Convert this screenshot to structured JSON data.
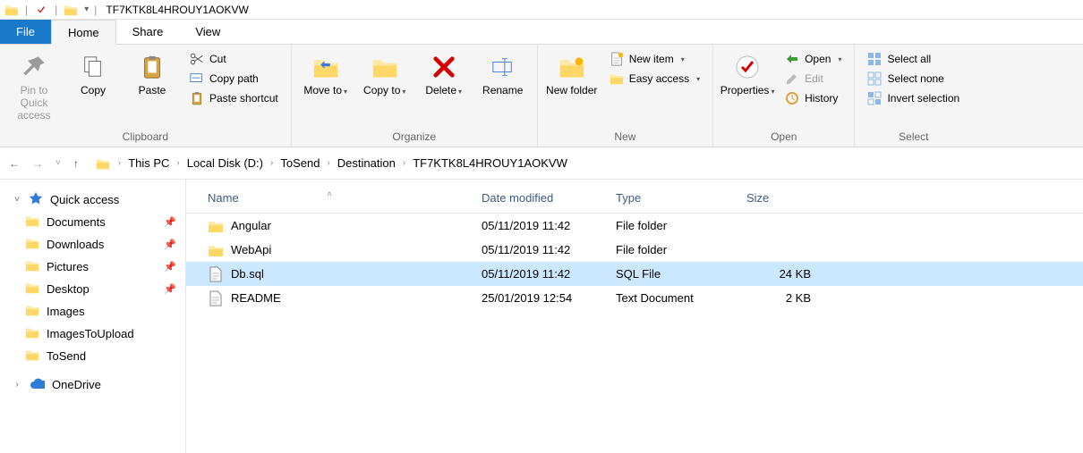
{
  "title": "TF7KTK8L4HROUY1AOKVW",
  "tabs": {
    "file": "File",
    "home": "Home",
    "share": "Share",
    "view": "View"
  },
  "ribbon": {
    "clipboard": {
      "label": "Clipboard",
      "pin": "Pin to Quick access",
      "copy": "Copy",
      "paste": "Paste",
      "cut": "Cut",
      "copy_path": "Copy path",
      "paste_shortcut": "Paste shortcut"
    },
    "organize": {
      "label": "Organize",
      "move_to": "Move to",
      "copy_to": "Copy to",
      "delete": "Delete",
      "rename": "Rename"
    },
    "new": {
      "label": "New",
      "new_folder": "New folder",
      "new_item": "New item",
      "easy_access": "Easy access"
    },
    "open": {
      "label": "Open",
      "properties": "Properties",
      "open": "Open",
      "edit": "Edit",
      "history": "History"
    },
    "select": {
      "label": "Select",
      "select_all": "Select all",
      "select_none": "Select none",
      "invert": "Invert selection"
    }
  },
  "breadcrumb": [
    "This PC",
    "Local Disk (D:)",
    "ToSend",
    "Destination",
    "TF7KTK8L4HROUY1AOKVW"
  ],
  "nav": {
    "quick_access": "Quick access",
    "items": [
      {
        "label": "Documents",
        "pinned": true
      },
      {
        "label": "Downloads",
        "pinned": true
      },
      {
        "label": "Pictures",
        "pinned": true
      },
      {
        "label": "Desktop",
        "pinned": true
      },
      {
        "label": "Images",
        "pinned": false
      },
      {
        "label": "ImagesToUpload",
        "pinned": false
      },
      {
        "label": "ToSend",
        "pinned": false
      }
    ],
    "onedrive": "OneDrive"
  },
  "columns": {
    "name": "Name",
    "date": "Date modified",
    "type": "Type",
    "size": "Size"
  },
  "rows": [
    {
      "name": "Angular",
      "date": "05/11/2019 11:42",
      "type": "File folder",
      "size": "",
      "icon": "folder",
      "selected": false
    },
    {
      "name": "WebApi",
      "date": "05/11/2019 11:42",
      "type": "File folder",
      "size": "",
      "icon": "folder",
      "selected": false
    },
    {
      "name": "Db.sql",
      "date": "05/11/2019 11:42",
      "type": "SQL File",
      "size": "24 KB",
      "icon": "file",
      "selected": true
    },
    {
      "name": "README",
      "date": "25/01/2019 12:54",
      "type": "Text Document",
      "size": "2 KB",
      "icon": "file",
      "selected": false
    }
  ]
}
